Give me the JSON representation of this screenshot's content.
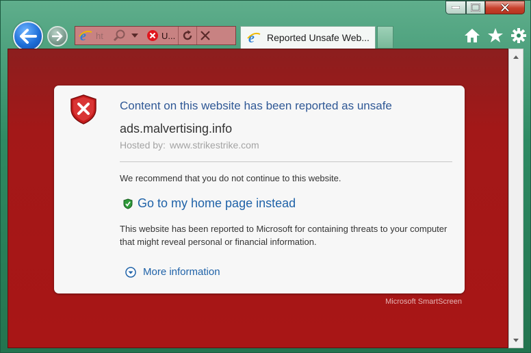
{
  "window": {
    "caption_buttons": [
      "minimize",
      "maximize",
      "close"
    ]
  },
  "navigation": {
    "address_text": "ht",
    "site_tab_label": "U...",
    "active_tab_title": "Reported Unsafe Web..."
  },
  "warning": {
    "heading": "Content on this website has been reported as unsafe",
    "domain": "ads.malvertising.info",
    "hosted_label": "Hosted by:",
    "hosted_value": "www.strikestrike.com",
    "recommendation": "We recommend that you do not continue to this website.",
    "home_link": "Go to my home page instead",
    "report_text": "This website has been reported to Microsoft for containing threats to your computer that might reveal personal or financial information.",
    "more_info": "More information",
    "footer": "Microsoft SmartScreen"
  },
  "colors": {
    "content_background": "#a81616",
    "heading": "#2f5895",
    "link": "#1f62a8",
    "frame": "#2e8a63"
  },
  "icons": [
    "back-arrow-icon",
    "forward-arrow-icon",
    "ie-logo-icon",
    "search-icon",
    "dropdown-icon",
    "error-icon",
    "refresh-icon",
    "stop-icon",
    "home-icon",
    "favorites-star-icon",
    "settings-gear-icon",
    "shield-error-icon",
    "green-shield-icon",
    "expand-circle-icon"
  ]
}
